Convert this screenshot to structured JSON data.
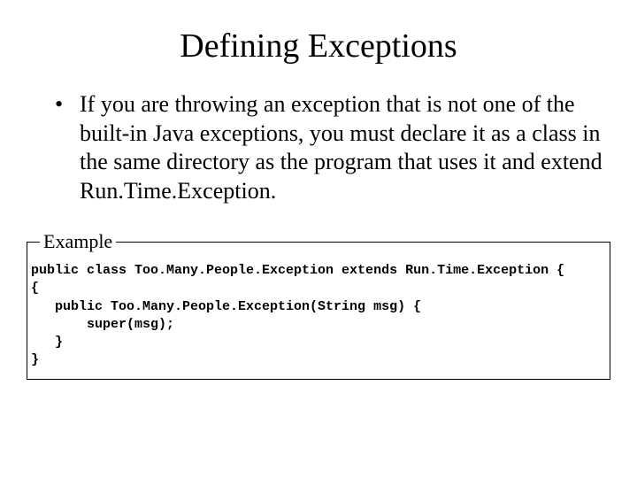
{
  "title": "Defining Exceptions",
  "bullet": "If you are throwing an exception that is not one of the built-in Java exceptions, you must declare it as a class in the same directory as the program that uses it and extend Run.Time.Exception.",
  "example_label": "Example",
  "code": {
    "l1": "public class Too.Many.People.Exception extends Run.Time.Exception {",
    "l2": "{",
    "l3": "   public Too.Many.People.Exception(String msg) {",
    "l4": "       super(msg);",
    "l5": "   }",
    "l6": "}"
  }
}
